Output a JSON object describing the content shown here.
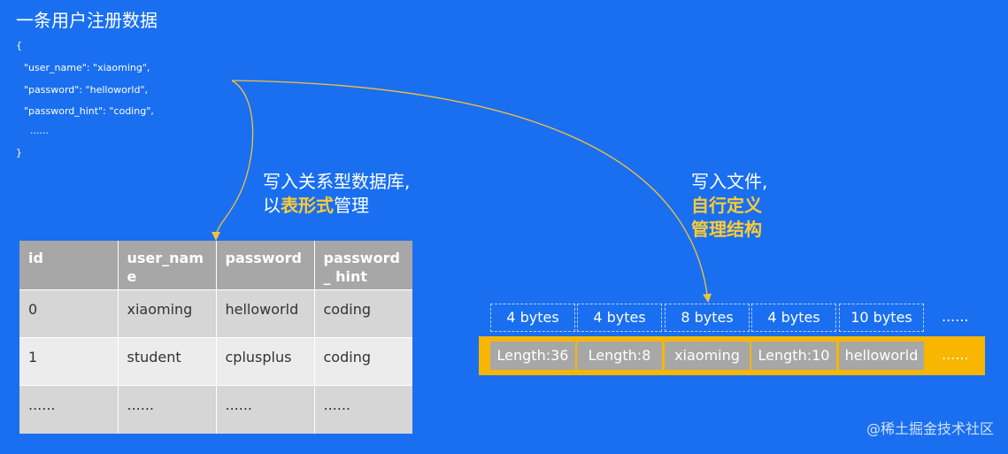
{
  "title": "一条用户注册数据",
  "json_lines": [
    "{",
    "\"user_name\": \"xiaoming\",",
    "\"password\": \"helloworld\",",
    "\"password_hint\": \"coding\",",
    "......",
    "}"
  ],
  "caption_db": {
    "line1": "写入关系型数据库,",
    "prefix": "以",
    "highlight": "表形式",
    "suffix": "管理"
  },
  "caption_file": {
    "line1": "写入文件,",
    "highlight1": "自行定义",
    "highlight2": "管理结构"
  },
  "table": {
    "headers": [
      "id",
      "user_name",
      "password",
      "password_ hint"
    ],
    "rows": [
      [
        "0",
        "xiaoming",
        "helloworld",
        "coding"
      ],
      [
        "1",
        "student",
        "cplusplus",
        "coding"
      ],
      [
        "......",
        "......",
        "......",
        "......"
      ]
    ]
  },
  "byte_sizes": [
    "4 bytes",
    "4 bytes",
    "8 bytes",
    "4 bytes",
    "10 bytes"
  ],
  "byte_ellipsis": "......",
  "fields": [
    "Length:36",
    "Length:8",
    "xiaoming",
    "Length:10",
    "helloworld"
  ],
  "field_ellipsis": "......",
  "watermark": "@稀土掘金技术社区",
  "colors": {
    "background": "#1a6ff0",
    "highlight": "#ffcc33",
    "field_bar": "#f8b600",
    "cell_gray": "#a7a7a7",
    "arrow": "#f3c23a"
  }
}
